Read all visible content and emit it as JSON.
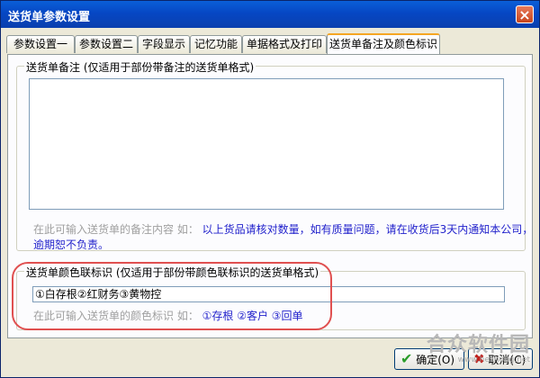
{
  "window": {
    "title": "送货单参数设置",
    "close_symbol": "×"
  },
  "tabs": [
    "参数设置一",
    "参数设置二",
    "字段显示",
    "记忆功能",
    "单据格式及打印",
    "送货单备注及颜色标识"
  ],
  "active_tab_index": 5,
  "remark_group": {
    "legend": "送货单备注 (仅适用于部份带备注的送货单格式)",
    "textarea_value": "",
    "hint_prefix": "在此可输入送货单的备注内容 如：",
    "hint_example_line1": "以上货品请核对数量，如有质量问题，请在收货后3天内通知本公司，",
    "hint_example_line2": "逾期恕不负责。"
  },
  "color_group": {
    "legend": "送货单颜色联标识 (仅适用于部份带颜色联标识的送货单格式)",
    "input_value": "①白存根②红财务③黄物控",
    "hint_prefix": "在此可输入送货单的颜色标识 如：",
    "hint_example": "①存根 ②客户 ③回单"
  },
  "buttons": {
    "ok": "确定(O)",
    "cancel": "取消(C)"
  },
  "watermark": {
    "text": "合众软件园",
    "url": "www.hezhong.net"
  },
  "colors": {
    "title_bar": "#0647c4",
    "hint_blue": "#2222cc",
    "highlight_oval": "#e05050"
  }
}
